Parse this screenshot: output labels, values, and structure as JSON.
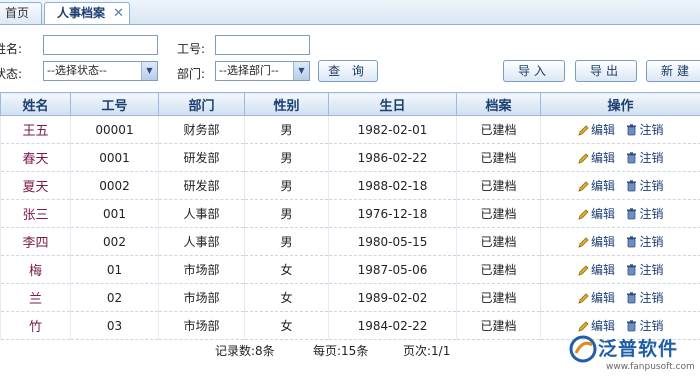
{
  "tabs": [
    {
      "label": "首页",
      "active": false
    },
    {
      "label": "人事档案",
      "active": true,
      "close": "✕"
    }
  ],
  "search": {
    "name_label": "姓名:",
    "id_label": "工号:",
    "status_label": "状态:",
    "status_value": "--选择状态--",
    "dept_label": "部门:",
    "dept_value": "--选择部门--",
    "query_button": "查 询"
  },
  "toolbar": {
    "import": "导入",
    "export": "导出",
    "new": "新建"
  },
  "table": {
    "headers": [
      "姓名",
      "工号",
      "部门",
      "性别",
      "生日",
      "档案",
      "操作"
    ],
    "rows": [
      {
        "name": "王五",
        "id": "00001",
        "dept": "财务部",
        "gender": "男",
        "birthday": "1982-02-01",
        "archive": "已建档"
      },
      {
        "name": "春天",
        "id": "0001",
        "dept": "研发部",
        "gender": "男",
        "birthday": "1986-02-22",
        "archive": "已建档"
      },
      {
        "name": "夏天",
        "id": "0002",
        "dept": "研发部",
        "gender": "男",
        "birthday": "1988-02-18",
        "archive": "已建档"
      },
      {
        "name": "张三",
        "id": "001",
        "dept": "人事部",
        "gender": "男",
        "birthday": "1976-12-18",
        "archive": "已建档"
      },
      {
        "name": "李四",
        "id": "002",
        "dept": "人事部",
        "gender": "男",
        "birthday": "1980-05-15",
        "archive": "已建档"
      },
      {
        "name": "梅",
        "id": "01",
        "dept": "市场部",
        "gender": "女",
        "birthday": "1987-05-06",
        "archive": "已建档"
      },
      {
        "name": "兰",
        "id": "02",
        "dept": "市场部",
        "gender": "女",
        "birthday": "1989-02-02",
        "archive": "已建档"
      },
      {
        "name": "竹",
        "id": "03",
        "dept": "市场部",
        "gender": "女",
        "birthday": "1984-02-22",
        "archive": "已建档"
      }
    ],
    "edit_label": "编辑",
    "cancel_label": "注销"
  },
  "footer": {
    "records": "记录数:8条",
    "per_page": "每页:15条",
    "page": "页次:1/1"
  },
  "brand": {
    "name": "泛普软件",
    "url": "www.fanpusoft.com"
  }
}
